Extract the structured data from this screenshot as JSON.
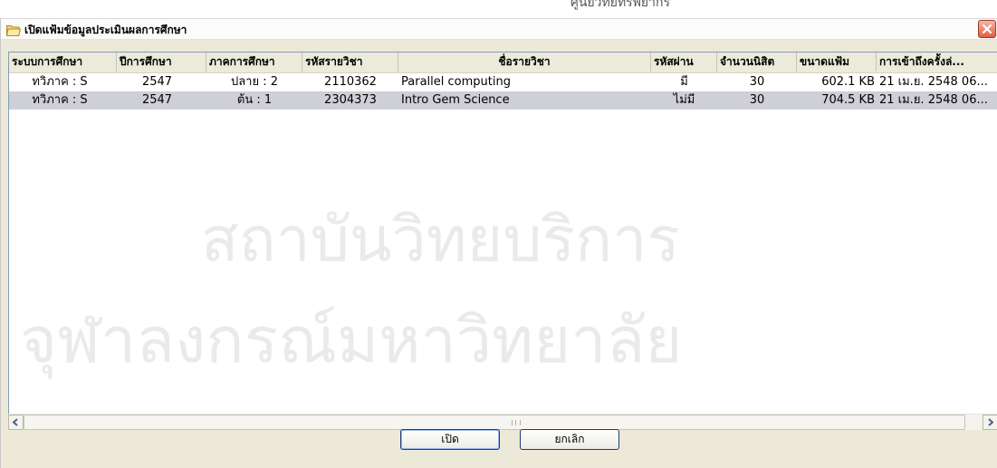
{
  "dialog": {
    "title": "เปิดแฟ้มข้อมูลประเมินผลการศึกษา"
  },
  "columns": [
    "ระบบการศึกษา",
    "ปีการศึกษา",
    "ภาคการศึกษา",
    "รหัสรายวิชา",
    "ชื่อรายวิชา",
    "รหัสผ่าน",
    "จำนวนนิสิต",
    "ขนาดแฟ้ม",
    "การเข้าถึงครั้งล่..."
  ],
  "rows": [
    {
      "system": "ทวิภาค : S",
      "year": "2547",
      "semester": "ปลาย : 2",
      "course_code": "2110362",
      "course_name": "Parallel computing",
      "password": "มี",
      "students": "30",
      "file_size": "602.1 KB",
      "last_access": "21 เม.ย. 2548 06...",
      "selected": false
    },
    {
      "system": "ทวิภาค : S",
      "year": "2547",
      "semester": "ต้น : 1",
      "course_code": "2304373",
      "course_name": "Intro Gem Science",
      "password": "ไม่มี",
      "students": "30",
      "file_size": "704.5 KB",
      "last_access": "21 เม.ย. 2548 06...",
      "selected": true
    }
  ],
  "watermark": {
    "top_text": "ศูนย์วิทยทรัพยากร",
    "line1": "สถาบันวิทยบริการ",
    "line2": "จุฬาลงกรณ์มหาวิทยาลัย"
  },
  "buttons": {
    "open": "เปิด",
    "cancel": "ยกเลิก"
  },
  "icons": {
    "title": "folder-open-icon",
    "close": "close-icon",
    "scroll_left": "arrow-left-icon",
    "scroll_right": "arrow-right-icon"
  },
  "colors": {
    "selection": "#cfcfd7",
    "close_button": "#e0603e",
    "watermark": "#ece9ea"
  }
}
